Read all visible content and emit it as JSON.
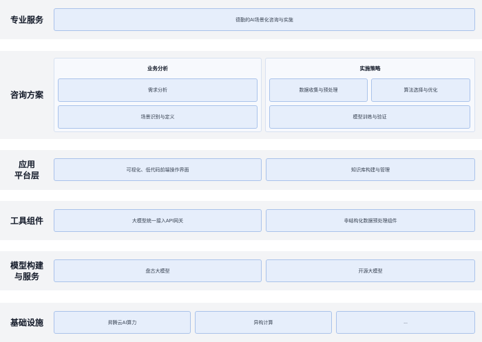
{
  "rows": {
    "service": {
      "label": "专业服务",
      "items": [
        "德勤的AI场景化咨询与实施"
      ]
    },
    "consult": {
      "label": "咨询方案",
      "groups": [
        {
          "title": "业务分析",
          "items": [
            "需求分析",
            "场景识别与定义"
          ]
        },
        {
          "title": "实施策略",
          "items": [
            "数据收集与预处理",
            "算法选择与优化",
            "模型训练与验证"
          ]
        }
      ]
    },
    "platform": {
      "label_line1": "应用",
      "label_line2": "平台层",
      "items": [
        "可视化、低代码前端操作界面",
        "知识库构建与管理"
      ]
    },
    "tools": {
      "label": "工具组件",
      "items": [
        "大模型统一接入API网关",
        "非结构化数据预处理组件"
      ]
    },
    "models": {
      "label_line1": "模型构建",
      "label_line2": "与服务",
      "items": [
        "盘古大模型",
        "开源大模型"
      ]
    },
    "infra": {
      "label": "基础设施",
      "items": [
        "昇腾云AI算力",
        "异构计算",
        "..."
      ]
    }
  }
}
